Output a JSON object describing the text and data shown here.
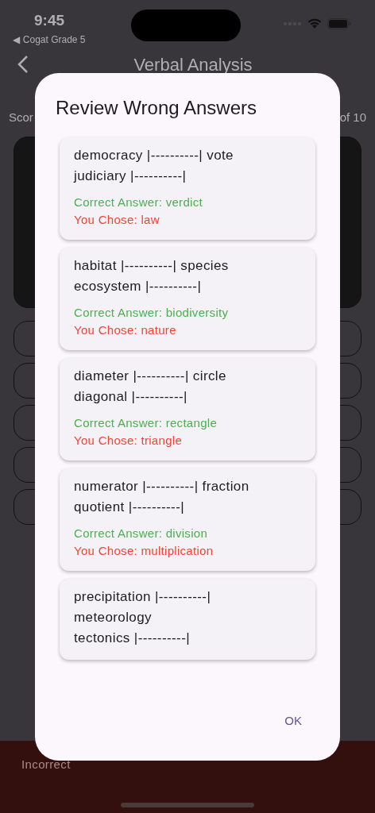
{
  "status_bar": {
    "time": "9:45",
    "back_app": "◀ Cogat Grade 5"
  },
  "header": {
    "title": "Verbal Analysis"
  },
  "score": {
    "left": "Scor",
    "right": "of 10"
  },
  "feedback": {
    "label": "Incorrect"
  },
  "dialog": {
    "title": "Review Wrong Answers",
    "items": [
      {
        "question": [
          "democracy |----------| vote",
          "judiciary |----------|"
        ],
        "correct": "Correct Answer: verdict",
        "chosen": "You Chose: law"
      },
      {
        "question": [
          "habitat |----------| species",
          "ecosystem |----------|"
        ],
        "correct": "Correct Answer: biodiversity",
        "chosen": "You Chose: nature"
      },
      {
        "question": [
          "diameter |----------| circle",
          "diagonal |----------|"
        ],
        "correct": "Correct Answer: rectangle",
        "chosen": "You Chose: triangle"
      },
      {
        "question": [
          "numerator |----------| fraction",
          "quotient |----------|"
        ],
        "correct": "Correct Answer: division",
        "chosen": "You Chose: multiplication"
      },
      {
        "question": [
          "precipitation |----------|",
          "meteorology",
          "tectonics |----------|"
        ]
      }
    ],
    "button": "OK"
  }
}
